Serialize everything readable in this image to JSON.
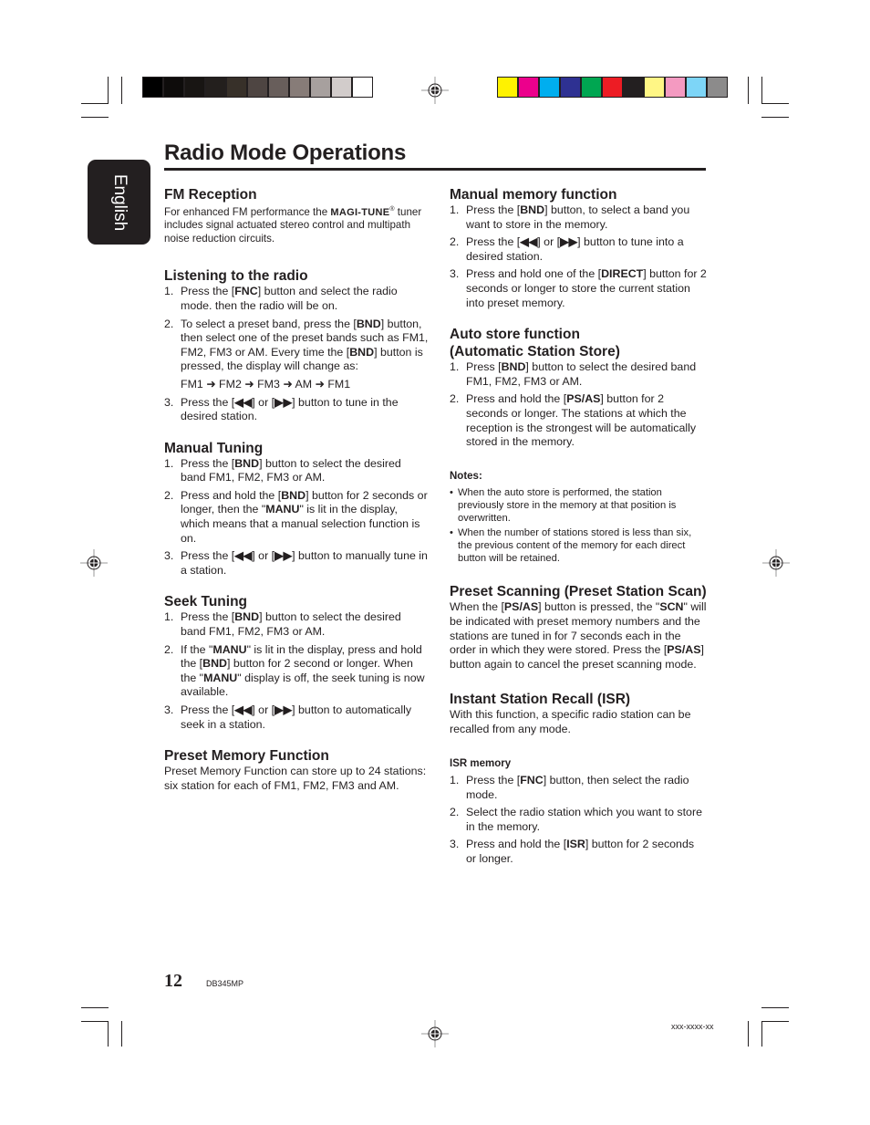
{
  "page": {
    "title": "Radio Mode Operations",
    "language_tab": "English",
    "page_number": "12",
    "model": "DB345MP",
    "part_code": "xxx-xxxx-xx"
  },
  "print_marks": {
    "grayscale_swatches": [
      "#000000",
      "#0e0c0b",
      "#181513",
      "#231f1d",
      "#373029",
      "#4e4542",
      "#685e5b",
      "#877c78",
      "#a7a09e",
      "#d2cccb",
      "#ffffff"
    ],
    "color_swatches": [
      "#fff200",
      "#ec008c",
      "#00aeef",
      "#2e3192",
      "#00a651",
      "#ed1c24",
      "#231f20",
      "#fff685",
      "#f49ac1",
      "#7dd5f7",
      "#8c8b8b"
    ]
  },
  "left_column": {
    "fm_reception": {
      "heading": "FM Reception",
      "text_before": "For enhanced FM performance the ",
      "brand": "MAGI-TUNE",
      "reg": "®",
      "text_after": " tuner includes signal actuated stereo control and multipath noise reduction circuits."
    },
    "listening": {
      "heading": "Listening to the radio",
      "items": [
        {
          "n": "1.",
          "parts": [
            "Press the [",
            "FNC",
            "] button and select the radio mode. then the radio will be on."
          ]
        },
        {
          "n": "2.",
          "parts": [
            "To select a preset band, press the [",
            "BND",
            "] button, then select one of the preset bands such as FM1, FM2, FM3 or AM. Every time the [",
            "BND",
            "] button is pressed, the display will change as:"
          ]
        },
        {
          "n": "",
          "text": "FM1 ➜ FM2 ➜ FM3 ➜ AM ➜ FM1"
        },
        {
          "n": "3.",
          "parts": [
            "Press the [",
            "◀◀",
            "] or [",
            "▶▶",
            "] button to tune in the desired station."
          ]
        }
      ]
    },
    "manual_tuning": {
      "heading": "Manual Tuning",
      "items": [
        {
          "n": "1.",
          "parts": [
            "Press the [",
            "BND",
            "] button to select the desired band FM1, FM2, FM3 or AM."
          ]
        },
        {
          "n": "2.",
          "parts": [
            "Press and hold the [",
            "BND",
            "] button for 2 seconds or longer, then the \"",
            "MANU",
            "\" is lit in the display, which means that a manual selection function is on."
          ]
        },
        {
          "n": "3.",
          "parts": [
            "Press the [",
            "◀◀",
            "] or [",
            "▶▶",
            "] button to manually tune in a station."
          ]
        }
      ]
    },
    "seek_tuning": {
      "heading": "Seek Tuning",
      "items": [
        {
          "n": "1.",
          "parts": [
            "Press the [",
            "BND",
            "] button to select the desired band FM1, FM2, FM3 or AM."
          ]
        },
        {
          "n": "2.",
          "parts": [
            "If the \"",
            "MANU",
            "\" is lit in the display, press and hold the [",
            "BND",
            "] button for 2 second or longer. When the \"",
            "MANU",
            "\" display is off, the seek tuning is now available."
          ]
        },
        {
          "n": "3.",
          "parts": [
            "Press the [",
            "◀◀",
            "] or [",
            "▶▶",
            "] button to automatically seek in a station."
          ]
        }
      ]
    },
    "preset_memory": {
      "heading": "Preset Memory Function",
      "text": "Preset Memory Function can store up to 24 stations: six station for each of FM1, FM2, FM3 and AM."
    }
  },
  "right_column": {
    "manual_memory": {
      "heading": "Manual memory function",
      "items": [
        {
          "n": "1.",
          "parts": [
            "Press the [",
            "BND",
            "] button, to select a band you want to store in the memory."
          ]
        },
        {
          "n": "2.",
          "parts": [
            "Press the [",
            "◀◀",
            "] or [",
            "▶▶",
            "] button to tune into a desired station."
          ]
        },
        {
          "n": "3.",
          "parts": [
            "Press and hold one of the [",
            "DIRECT",
            "] button for 2 seconds or longer to store the current station into preset memory."
          ]
        }
      ]
    },
    "auto_store": {
      "heading_line1": "Auto store function",
      "heading_line2": "(Automatic Station Store)",
      "items": [
        {
          "n": "1.",
          "parts": [
            "Press [",
            "BND",
            "] button to select the desired band FM1, FM2, FM3 or AM."
          ]
        },
        {
          "n": "2.",
          "parts": [
            "Press and hold the [",
            "PS/AS",
            "] button for 2 seconds or longer. The stations at which the reception is the strongest will be automatically stored in the memory."
          ]
        }
      ]
    },
    "notes": {
      "heading": "Notes:",
      "items": [
        "When the auto store is performed, the station previously store in the memory at that position is overwritten.",
        "When the number of stations stored is less than six, the previous content of the memory for each direct button will be retained."
      ]
    },
    "preset_scanning": {
      "heading": "Preset Scanning (Preset Station Scan)",
      "parts": [
        "When the [",
        "PS/AS",
        "] button is pressed, the \"",
        "SCN",
        "\" will be indicated with preset memory numbers and the stations are tuned in for 7 seconds each in the order in which they were stored. Press the [",
        "PS/AS",
        "] button again to cancel the preset scanning mode."
      ]
    },
    "isr": {
      "heading": "Instant Station Recall (ISR)",
      "text": "With this function, a specific radio station can be recalled from any mode.",
      "sub_heading": "ISR memory",
      "items": [
        {
          "n": "1.",
          "parts": [
            "Press the [",
            "FNC",
            "] button, then select the radio mode."
          ]
        },
        {
          "n": "2.",
          "parts": [
            "Select the radio station which you want to store in the memory."
          ]
        },
        {
          "n": "3.",
          "parts": [
            "Press and hold the [",
            "ISR",
            "] button for 2 seconds or longer."
          ]
        }
      ]
    }
  }
}
